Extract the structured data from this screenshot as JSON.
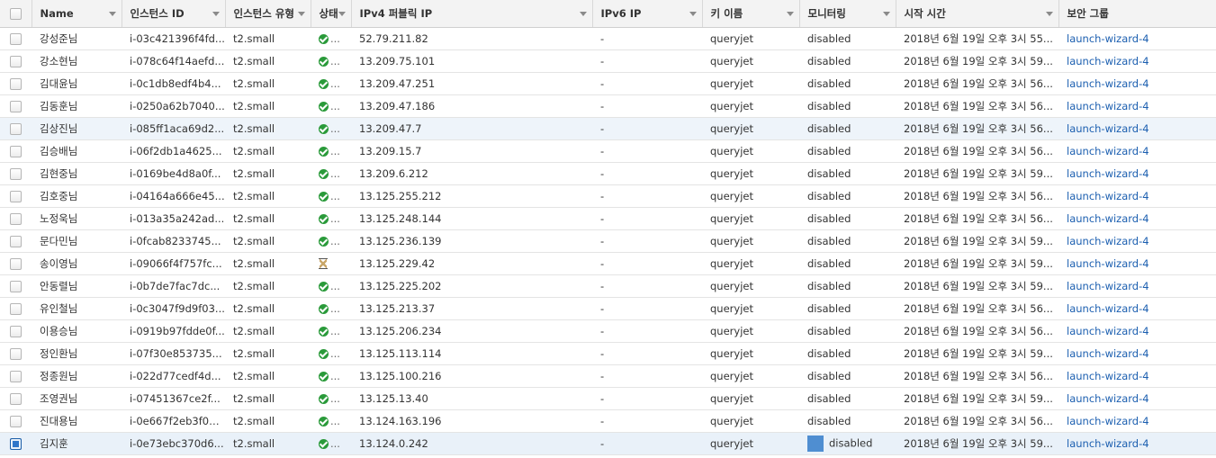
{
  "headers": [
    "Name",
    "인스턴스 ID",
    "인스턴스 유형",
    "상태",
    "IPv4 퍼블릭 IP",
    "IPv6 IP",
    "키 이름",
    "모니터링",
    "시작 시간",
    "보안 그룹"
  ],
  "rows": [
    {
      "name": "강성준님",
      "id": "i-03c421396f4fd...",
      "type": "t2.small",
      "state": "ok",
      "ip": "52.79.211.82",
      "ipv6": "-",
      "key": "queryjet",
      "mon": "disabled",
      "start": "2018년 6월 19일 오후 3시 55...",
      "sg": "launch-wizard-4"
    },
    {
      "name": "강소현님",
      "id": "i-078c64f14aefd...",
      "type": "t2.small",
      "state": "ok",
      "ip": "13.209.75.101",
      "ipv6": "-",
      "key": "queryjet",
      "mon": "disabled",
      "start": "2018년 6월 19일 오후 3시 59...",
      "sg": "launch-wizard-4"
    },
    {
      "name": "김대윤님",
      "id": "i-0c1db8edf4b4...",
      "type": "t2.small",
      "state": "ok",
      "ip": "13.209.47.251",
      "ipv6": "-",
      "key": "queryjet",
      "mon": "disabled",
      "start": "2018년 6월 19일 오후 3시 56...",
      "sg": "launch-wizard-4"
    },
    {
      "name": "김동훈님",
      "id": "i-0250a62b7040...",
      "type": "t2.small",
      "state": "ok",
      "ip": "13.209.47.186",
      "ipv6": "-",
      "key": "queryjet",
      "mon": "disabled",
      "start": "2018년 6월 19일 오후 3시 56...",
      "sg": "launch-wizard-4"
    },
    {
      "name": "김상진님",
      "id": "i-085ff1aca69d2...",
      "type": "t2.small",
      "state": "ok",
      "ip": "13.209.47.7",
      "ipv6": "-",
      "key": "queryjet",
      "mon": "disabled",
      "start": "2018년 6월 19일 오후 3시 56...",
      "sg": "launch-wizard-4"
    },
    {
      "name": "김승배님",
      "id": "i-06f2db1a4625...",
      "type": "t2.small",
      "state": "ok",
      "ip": "13.209.15.7",
      "ipv6": "-",
      "key": "queryjet",
      "mon": "disabled",
      "start": "2018년 6월 19일 오후 3시 56...",
      "sg": "launch-wizard-4"
    },
    {
      "name": "김현중님",
      "id": "i-0169be4d8a0f...",
      "type": "t2.small",
      "state": "ok",
      "ip": "13.209.6.212",
      "ipv6": "-",
      "key": "queryjet",
      "mon": "disabled",
      "start": "2018년 6월 19일 오후 3시 59...",
      "sg": "launch-wizard-4"
    },
    {
      "name": "김호중님",
      "id": "i-04164a666e45...",
      "type": "t2.small",
      "state": "ok",
      "ip": "13.125.255.212",
      "ipv6": "-",
      "key": "queryjet",
      "mon": "disabled",
      "start": "2018년 6월 19일 오후 3시 56...",
      "sg": "launch-wizard-4"
    },
    {
      "name": "노정욱님",
      "id": "i-013a35a242ad...",
      "type": "t2.small",
      "state": "ok",
      "ip": "13.125.248.144",
      "ipv6": "-",
      "key": "queryjet",
      "mon": "disabled",
      "start": "2018년 6월 19일 오후 3시 56...",
      "sg": "launch-wizard-4"
    },
    {
      "name": "문다민님",
      "id": "i-0fcab8233745...",
      "type": "t2.small",
      "state": "ok",
      "ip": "13.125.236.139",
      "ipv6": "-",
      "key": "queryjet",
      "mon": "disabled",
      "start": "2018년 6월 19일 오후 3시 59...",
      "sg": "launch-wizard-4"
    },
    {
      "name": "송이영님",
      "id": "i-09066f4f757fc...",
      "type": "t2.small",
      "state": "pending",
      "ip": "13.125.229.42",
      "ipv6": "-",
      "key": "queryjet",
      "mon": "disabled",
      "start": "2018년 6월 19일 오후 3시 59...",
      "sg": "launch-wizard-4"
    },
    {
      "name": "안동렬님",
      "id": "i-0b7de7fac7dc...",
      "type": "t2.small",
      "state": "ok",
      "ip": "13.125.225.202",
      "ipv6": "-",
      "key": "queryjet",
      "mon": "disabled",
      "start": "2018년 6월 19일 오후 3시 59...",
      "sg": "launch-wizard-4"
    },
    {
      "name": "유인철님",
      "id": "i-0c3047f9d9f03...",
      "type": "t2.small",
      "state": "ok",
      "ip": "13.125.213.37",
      "ipv6": "-",
      "key": "queryjet",
      "mon": "disabled",
      "start": "2018년 6월 19일 오후 3시 56...",
      "sg": "launch-wizard-4"
    },
    {
      "name": "이용승님",
      "id": "i-0919b97fdde0f...",
      "type": "t2.small",
      "state": "ok",
      "ip": "13.125.206.234",
      "ipv6": "-",
      "key": "queryjet",
      "mon": "disabled",
      "start": "2018년 6월 19일 오후 3시 56...",
      "sg": "launch-wizard-4"
    },
    {
      "name": "정인환님",
      "id": "i-07f30e853735...",
      "type": "t2.small",
      "state": "ok",
      "ip": "13.125.113.114",
      "ipv6": "-",
      "key": "queryjet",
      "mon": "disabled",
      "start": "2018년 6월 19일 오후 3시 59...",
      "sg": "launch-wizard-4"
    },
    {
      "name": "정종원님",
      "id": "i-022d77cedf4d...",
      "type": "t2.small",
      "state": "ok",
      "ip": "13.125.100.216",
      "ipv6": "-",
      "key": "queryjet",
      "mon": "disabled",
      "start": "2018년 6월 19일 오후 3시 56...",
      "sg": "launch-wizard-4"
    },
    {
      "name": "조영권님",
      "id": "i-07451367ce2f...",
      "type": "t2.small",
      "state": "ok",
      "ip": "13.125.13.40",
      "ipv6": "-",
      "key": "queryjet",
      "mon": "disabled",
      "start": "2018년 6월 19일 오후 3시 59...",
      "sg": "launch-wizard-4"
    },
    {
      "name": "진대용님",
      "id": "i-0e667f2eb3f0e...",
      "type": "t2.small",
      "state": "ok",
      "ip": "13.124.163.196",
      "ipv6": "-",
      "key": "queryjet",
      "mon": "disabled",
      "start": "2018년 6월 19일 오후 3시 56...",
      "sg": "launch-wizard-4"
    },
    {
      "name": "김지훈",
      "id": "i-0e73ebc370d6...",
      "type": "t2.small",
      "state": "ok",
      "ip": "13.124.0.242",
      "ipv6": "-",
      "key": "queryjet",
      "mon": "disabled",
      "start": "2018년 6월 19일 오후 3시 59...",
      "sg": "launch-wizard-4",
      "selected": true
    }
  ],
  "highlight_row_index": 4,
  "colors": {
    "accent": "#2f76c9",
    "link": "#1c5fb0",
    "ok": "#2a9a3a",
    "header_bg": "#f3f3f3"
  },
  "icons": {
    "ok": "check-circle-icon",
    "pending": "hourglass-icon",
    "sort": "caret-down-icon"
  }
}
